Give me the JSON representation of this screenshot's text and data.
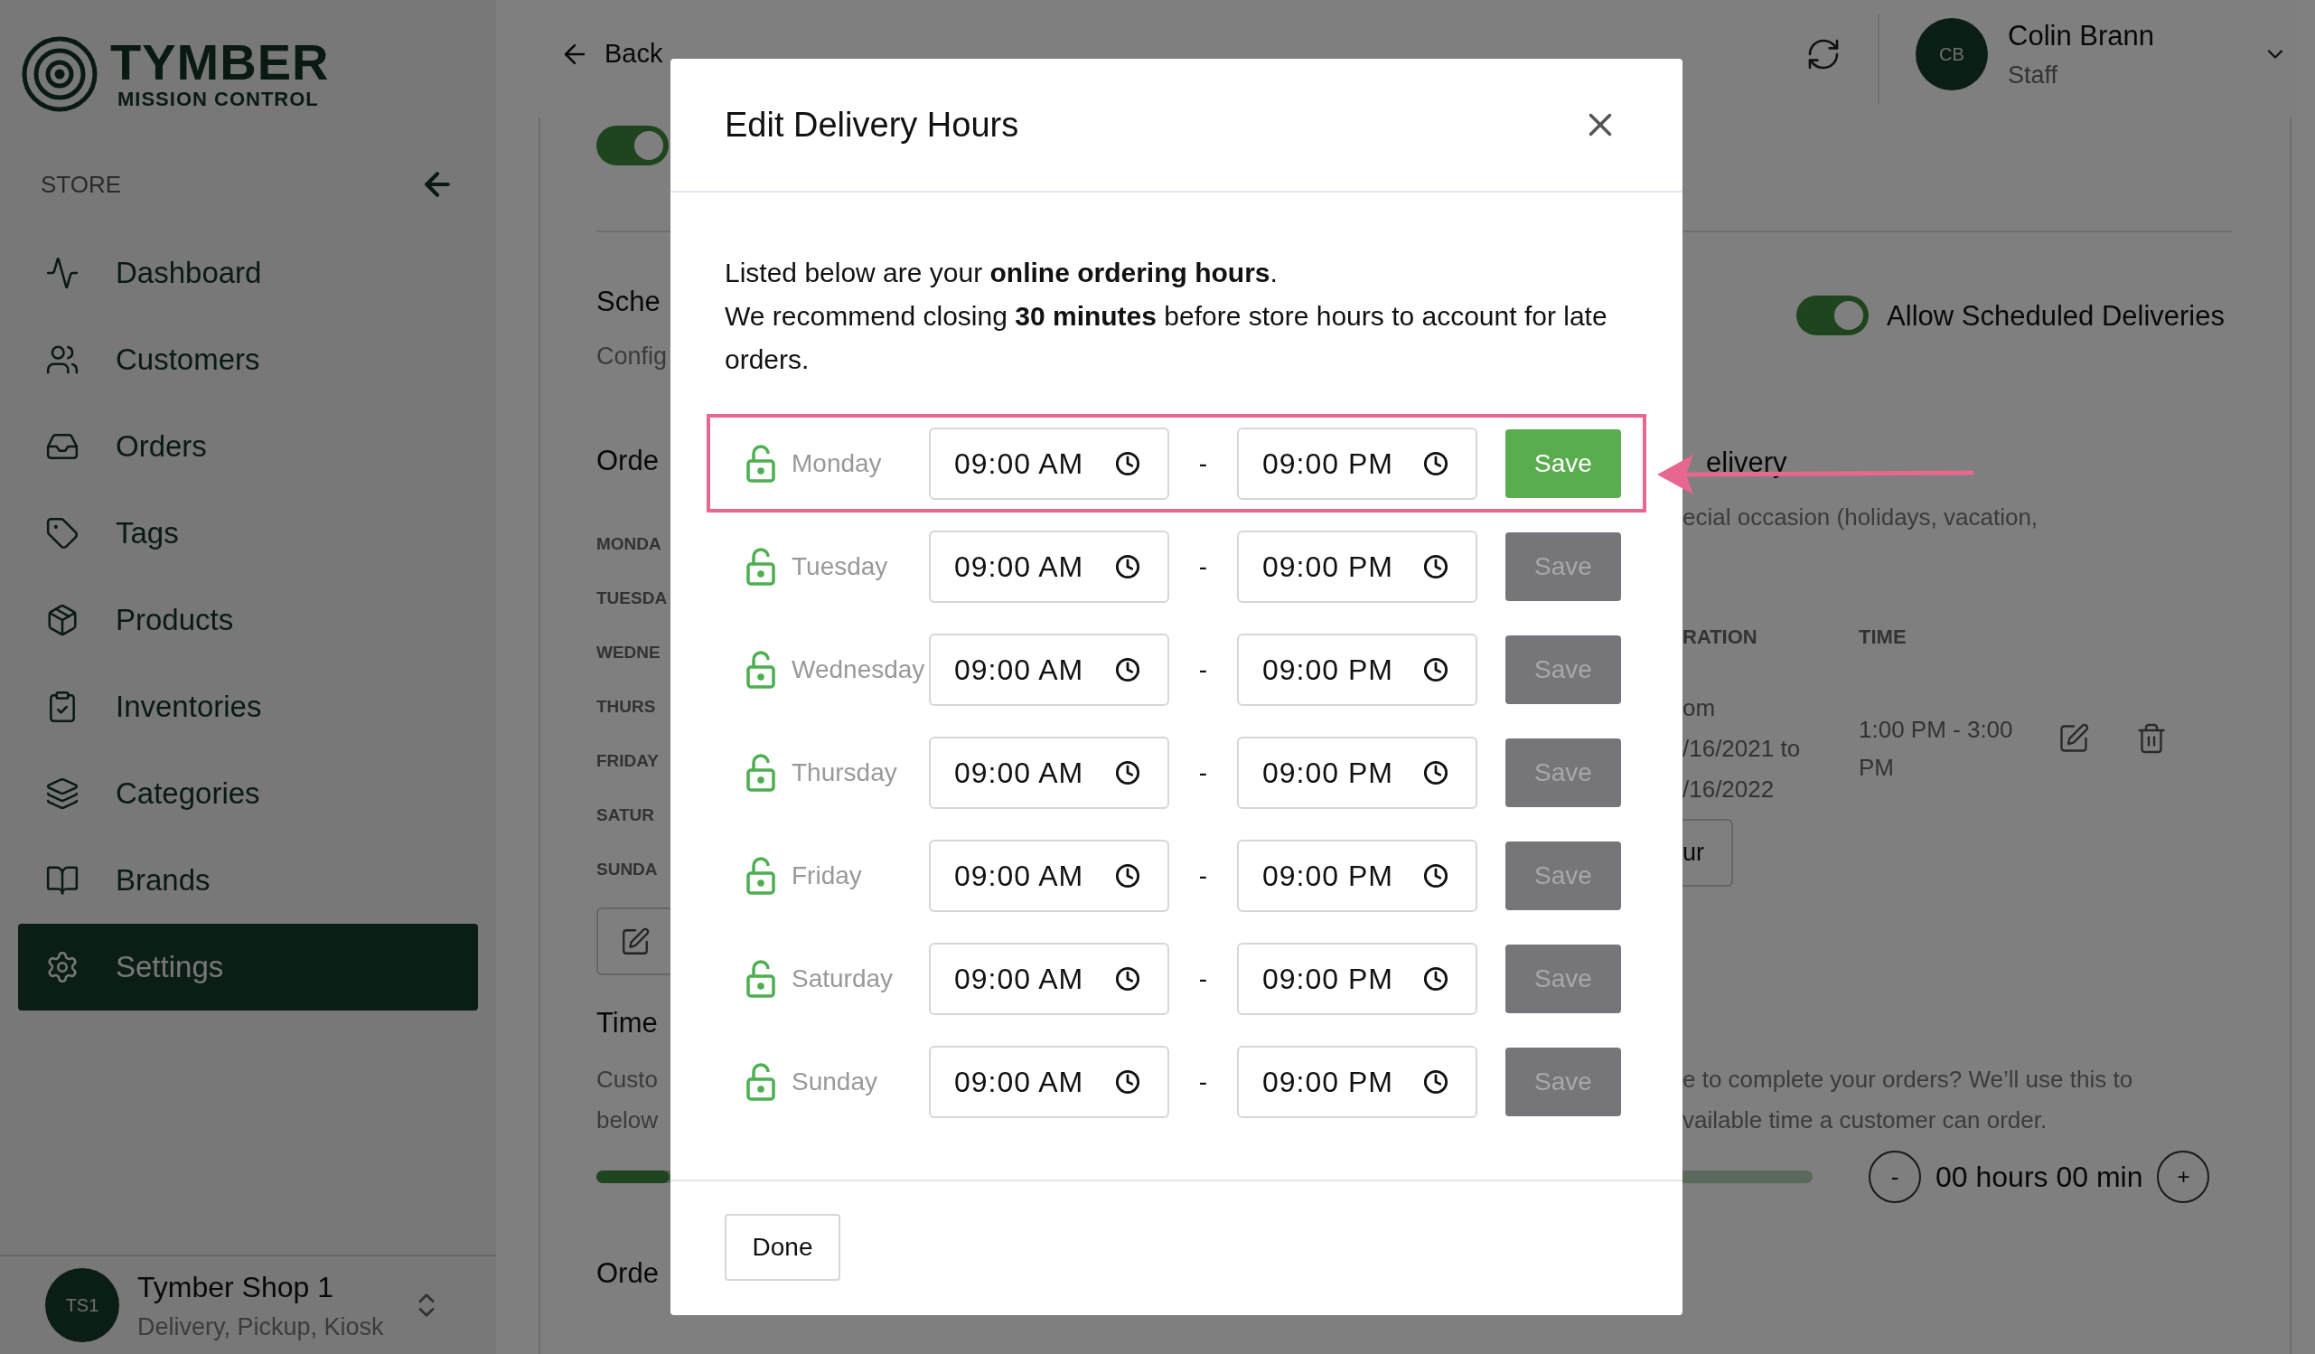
{
  "sidebar": {
    "logo_title": "TYMBER",
    "logo_subtitle": "MISSION CONTROL",
    "section": "STORE",
    "items": [
      {
        "label": "Dashboard",
        "selected": false
      },
      {
        "label": "Customers",
        "selected": false
      },
      {
        "label": "Orders",
        "selected": false
      },
      {
        "label": "Tags",
        "selected": false
      },
      {
        "label": "Products",
        "selected": false
      },
      {
        "label": "Inventories",
        "selected": false
      },
      {
        "label": "Categories",
        "selected": false
      },
      {
        "label": "Brands",
        "selected": false
      },
      {
        "label": "Settings",
        "selected": true
      }
    ],
    "store": {
      "initials": "TS1",
      "name": "Tymber Shop 1",
      "services": "Delivery, Pickup, Kiosk"
    }
  },
  "topbar": {
    "back": "Back",
    "user": {
      "initials": "CB",
      "name": "Colin Brann",
      "role": "Staff"
    }
  },
  "background": {
    "left": {
      "toggle_on": true,
      "heading_1": "Sche",
      "subtitle_1": "Config",
      "heading_2": "Orde",
      "days": [
        "MONDA",
        "TUESDA",
        "WEDNE",
        "THURS",
        "FRIDAY",
        "SATUR",
        "SUNDA"
      ],
      "heading_3": "Time",
      "text_lines": [
        "Custo",
        "below"
      ],
      "heading_4": "Orde"
    },
    "right": {
      "toggle": {
        "label": "Allow Scheduled Deliveries",
        "on": true
      },
      "heading": "elivery",
      "description": "ecial occasion (holidays, vacation,",
      "columns": [
        "RATION",
        "TIME"
      ],
      "duration": [
        "om",
        "/16/2021 to",
        "/16/2022"
      ],
      "time": "1:00 PM - 3:00 PM",
      "button": "ur",
      "text_lines": [
        "e to complete your orders? We’ll use this to",
        "vailable time a customer can order."
      ]
    },
    "slider": {
      "level": 0.06
    },
    "stepper": {
      "decrement": "-",
      "value": "00 hours 00 min",
      "increment": "+"
    }
  },
  "modal": {
    "title": "Edit Delivery Hours",
    "intro": [
      "Listed below are your **online ordering hours**.",
      "We recommend closing **30 minutes** before store hours to account for late orders."
    ],
    "rows": [
      {
        "day": "Monday",
        "start": "09:00 AM",
        "separator": "-",
        "end": "09:00 PM",
        "save": "Save",
        "disabled": false,
        "highlighted": true
      },
      {
        "day": "Tuesday",
        "start": "09:00 AM",
        "separator": "-",
        "end": "09:00 PM",
        "save": "Save",
        "disabled": true,
        "highlighted": false
      },
      {
        "day": "Wednesday",
        "start": "09:00 AM",
        "separator": "-",
        "end": "09:00 PM",
        "save": "Save",
        "disabled": true,
        "highlighted": false
      },
      {
        "day": "Thursday",
        "start": "09:00 AM",
        "separator": "-",
        "end": "09:00 PM",
        "save": "Save",
        "disabled": true,
        "highlighted": false
      },
      {
        "day": "Friday",
        "start": "09:00 AM",
        "separator": "-",
        "end": "09:00 PM",
        "save": "Save",
        "disabled": true,
        "highlighted": false
      },
      {
        "day": "Saturday",
        "start": "09:00 AM",
        "separator": "-",
        "end": "09:00 PM",
        "save": "Save",
        "disabled": true,
        "highlighted": false
      },
      {
        "day": "Sunday",
        "start": "09:00 AM",
        "separator": "-",
        "end": "09:00 PM",
        "save": "Save",
        "disabled": true,
        "highlighted": false
      }
    ],
    "done": "Done"
  }
}
